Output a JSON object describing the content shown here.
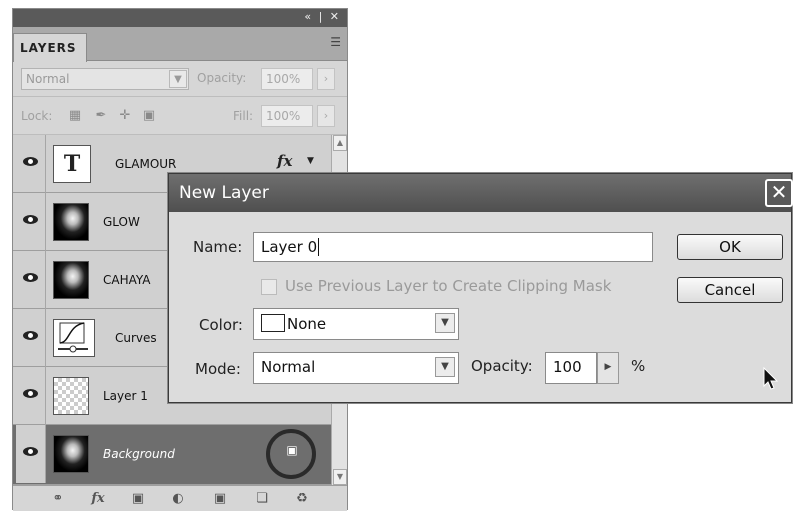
{
  "panel": {
    "controls": "« | ✕",
    "tab": "LAYERS",
    "menu_icon": "☰",
    "blend_mode": "Normal",
    "opacity_label": "Opacity:",
    "opacity_value": "100%",
    "lock_label": "Lock:",
    "fill_label": "Fill:",
    "fill_value": "100%",
    "layers": [
      {
        "name": "GLAMOUR",
        "thumb": "T"
      },
      {
        "name": "GLOW"
      },
      {
        "name": "CAHAYA"
      },
      {
        "name": "Curves"
      },
      {
        "name": "Layer 1"
      },
      {
        "name": "Background"
      }
    ],
    "fx": "fx",
    "bottom_icons": [
      "link-icon",
      "fx-icon",
      "mask-icon",
      "adjustment-icon",
      "folder-icon",
      "new-layer-icon",
      "trash-icon"
    ]
  },
  "dialog": {
    "title": "New Layer",
    "name_label": "Name:",
    "name_value": "Layer 0",
    "clip_label": "Use Previous Layer to Create Clipping Mask",
    "color_label": "Color:",
    "color_value": "None",
    "mode_label": "Mode:",
    "mode_value": "Normal",
    "opacity_label": "Opacity:",
    "opacity_value": "100",
    "percent": "%",
    "ok_label": "OK",
    "cancel_label": "Cancel",
    "close": "✕"
  }
}
